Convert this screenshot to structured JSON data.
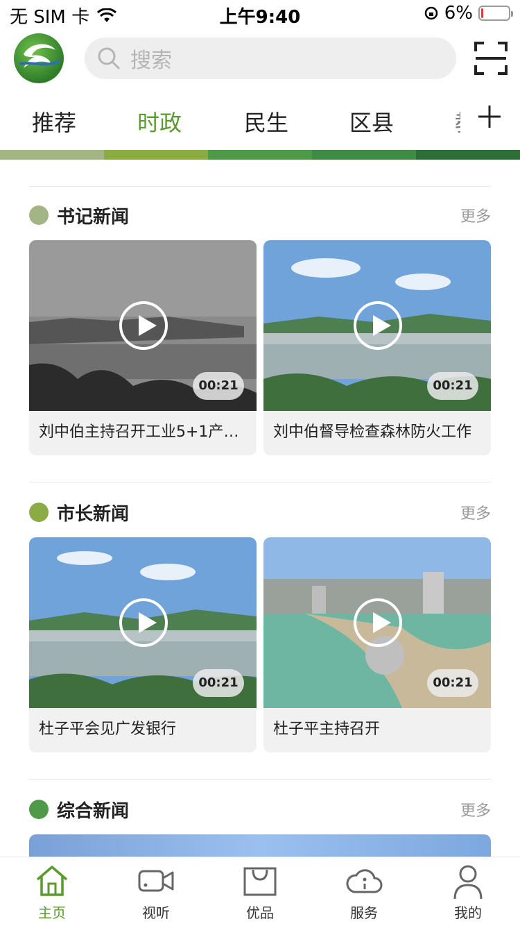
{
  "status_bar": {
    "carrier": "无 SIM 卡",
    "time": "上午9:40",
    "battery": "6%",
    "battery_level": 0.06
  },
  "header": {
    "search_placeholder": "搜索"
  },
  "tabs": [
    {
      "label": "推荐"
    },
    {
      "label": "时政"
    },
    {
      "label": "民生"
    },
    {
      "label": "区县"
    },
    {
      "label": "教"
    }
  ],
  "strip_colors": [
    "#a3b485",
    "#8bab45",
    "#4f9a49",
    "#3f8a45",
    "#2e6e38"
  ],
  "sections": [
    {
      "title": "书记新闻",
      "more": "更多",
      "dot_color": "#a3b485",
      "cards": [
        {
          "caption": "刘中伯主持召开工业5+1产业链...",
          "duration": "00:21"
        },
        {
          "caption": "刘中伯督导检查森林防火工作",
          "duration": "00:21"
        }
      ]
    },
    {
      "title": "市长新闻",
      "more": "更多",
      "dot_color": "#8bab45",
      "cards": [
        {
          "caption": "杜子平会见广发银行",
          "duration": "00:21"
        },
        {
          "caption": "杜子平主持召开",
          "duration": "00:21"
        }
      ]
    },
    {
      "title": "综合新闻",
      "more": "更多",
      "dot_color": "#4f9a49"
    }
  ],
  "bottom_nav": [
    {
      "label": "主页"
    },
    {
      "label": "视听"
    },
    {
      "label": "优品"
    },
    {
      "label": "服务"
    },
    {
      "label": "我的"
    }
  ],
  "colors": {
    "accent": "#5a9a2e"
  }
}
